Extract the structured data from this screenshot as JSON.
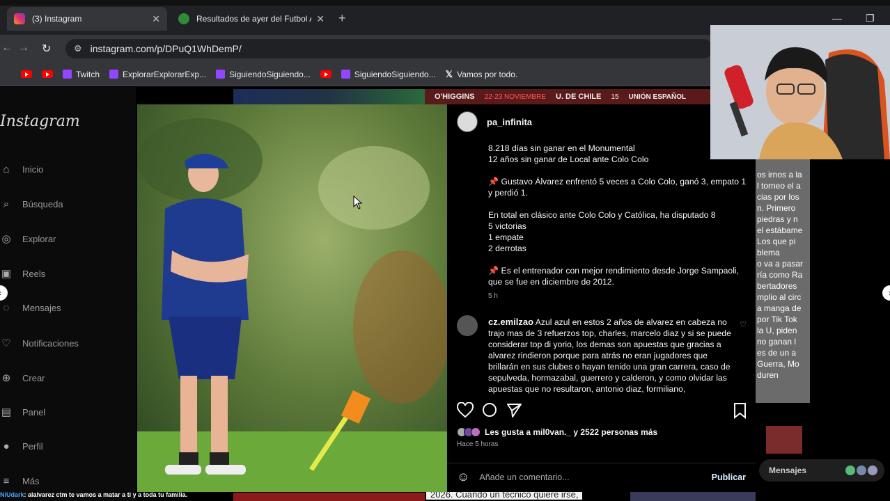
{
  "browser": {
    "tabs": [
      {
        "title": "(3) Instagram",
        "active": true
      },
      {
        "title": "Resultados de ayer del Futbol A",
        "active": false
      }
    ],
    "new_tab": "+",
    "url": "instagram.com/p/DPuQ1WhDemP/",
    "bookmarks": [
      {
        "type": "youtube",
        "label": ""
      },
      {
        "type": "youtube",
        "label": ""
      },
      {
        "type": "twitch",
        "label": "Twitch"
      },
      {
        "type": "twitch",
        "label": "ExplorarExplorarExp..."
      },
      {
        "type": "twitch",
        "label": "SiguiendoSiguiendo..."
      },
      {
        "type": "youtube",
        "label": ""
      },
      {
        "type": "twitch",
        "label": "SiguiendoSiguiendo..."
      },
      {
        "type": "x",
        "label": "Vamos por todo."
      }
    ]
  },
  "instagram": {
    "logo": "Instagram",
    "nav": [
      "Inicio",
      "Búsqueda",
      "Explorar",
      "Reels",
      "Mensajes",
      "Notificaciones",
      "Crear",
      "Panel",
      "Perfil",
      "Más"
    ],
    "messages_pill": "Mensajes"
  },
  "background": {
    "strip_labels": [
      "O'HIGGINS",
      "22-23 NOVIEMBRE",
      "U. DE CHILE",
      "15",
      "UNIÓN ESPAÑOL"
    ],
    "right_text": [
      "os irnos a la",
      "l torneo el a",
      "cias por los",
      "n. Primero",
      "piedras y n",
      "el estábame",
      "Los que pi",
      "blema",
      "o va a pasar",
      "ría como Ra",
      "bertadores",
      "mplio al circ",
      "a manga de",
      "por Tik Tok",
      "la U, piden",
      "no ganan l",
      "es de un a",
      "Guerra, Mo",
      "duren"
    ],
    "bottom_text": "2026. Cuando un técnico quiere irse,"
  },
  "post": {
    "author": "pa_infinita",
    "caption": [
      "8.218 días sin ganar en el Monumental",
      "12 años sin ganar de Local ante Colo Colo",
      "📌 Gustavo Álvarez enfrentó 5 veces a Colo Colo, ganó 3, empato 1 y perdió 1.",
      "En total en clásico ante Colo Colo y Católica, ha disputado 8",
      "5 victorias",
      "1 empate",
      "2 derrotas",
      "📌 Es el entrenador con mejor rendimiento desde Jorge Sampaoli, que se fue en diciembre de 2012."
    ],
    "caption_time": "5 h",
    "comment": {
      "user": "cz.emilzao",
      "text": "Azul azul en estos 2 años de alvarez en cabeza no trajo mas de 3 refuerzos top, charles, marcelo diaz y si se puede considerar top di yorio, los demas son apuestas que gracias a alvarez rindieron porque para atrás no eran jugadores que brillarán en sus clubes o hayan tenido una gran carrera, caso de sepulveda, hormazabal, guerrero y calderon, y como olvidar las apuestas que no resultaron, antonio diaz, formiliano,"
    },
    "likes_text": "Les gusta a mil0van._ y 2522 personas más",
    "posted": "Hace 5 horas",
    "comment_placeholder": "Añade un comentario...",
    "publish": "Publicar"
  },
  "chat": {
    "user": "NiUdark",
    "message": ": alalvarez ctm te vamos a matar a ti y a toda tu familia."
  },
  "colors": {
    "instagram_bg": "#000000",
    "tab_active": "#35363a",
    "chrome_dark": "#202124",
    "twitch": "#9146ff",
    "youtube": "#ff0000",
    "publish_link": "#e0f1ff"
  },
  "icons": [
    "search-icon",
    "home-icon",
    "compass-icon",
    "reels-icon",
    "messenger-icon",
    "heart-icon",
    "plus-icon",
    "dashboard-icon",
    "menu-icon",
    "comment-icon",
    "share-icon",
    "bookmark-icon",
    "emoji-icon"
  ]
}
